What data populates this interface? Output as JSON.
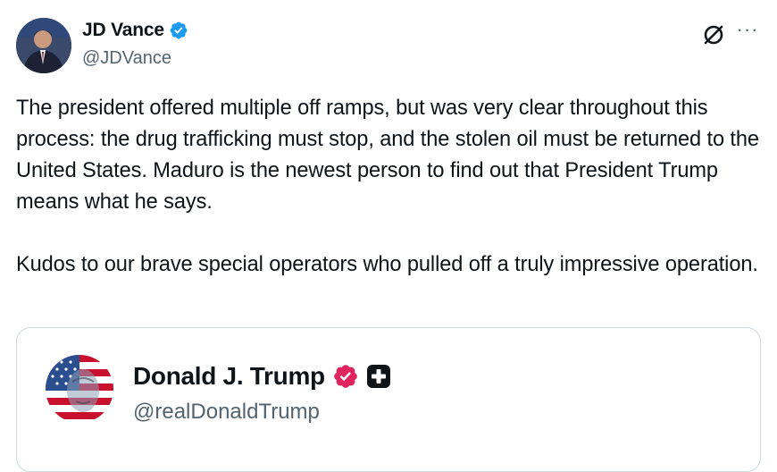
{
  "author": {
    "display_name": "JD Vance",
    "handle": "@JDVance",
    "verified_badge": "blue-check",
    "badge_color": "#1d9bf0"
  },
  "actions": {
    "grok_icon": "grok-icon",
    "more_icon": "more-options-icon",
    "more_symbol": "···"
  },
  "post": {
    "paragraph_1": "The president offered multiple off ramps, but was very clear throughout this process: the drug trafficking must stop, and the stolen oil must be returned to the United States. Maduro is the newest person to find out that President Trump means what he says.",
    "paragraph_2": "Kudos to our brave special operators who pulled off a truly impressive operation."
  },
  "quoted_post": {
    "display_name": "Donald J. Trump",
    "handle": "@realDonaldTrump",
    "verified_badge": "gold-check",
    "badge_color": "#e0245e",
    "affiliate_icon": "affiliate-square-icon"
  },
  "colors": {
    "text": "#0f1419",
    "secondary_text": "#536471",
    "border": "#cfd9de"
  }
}
